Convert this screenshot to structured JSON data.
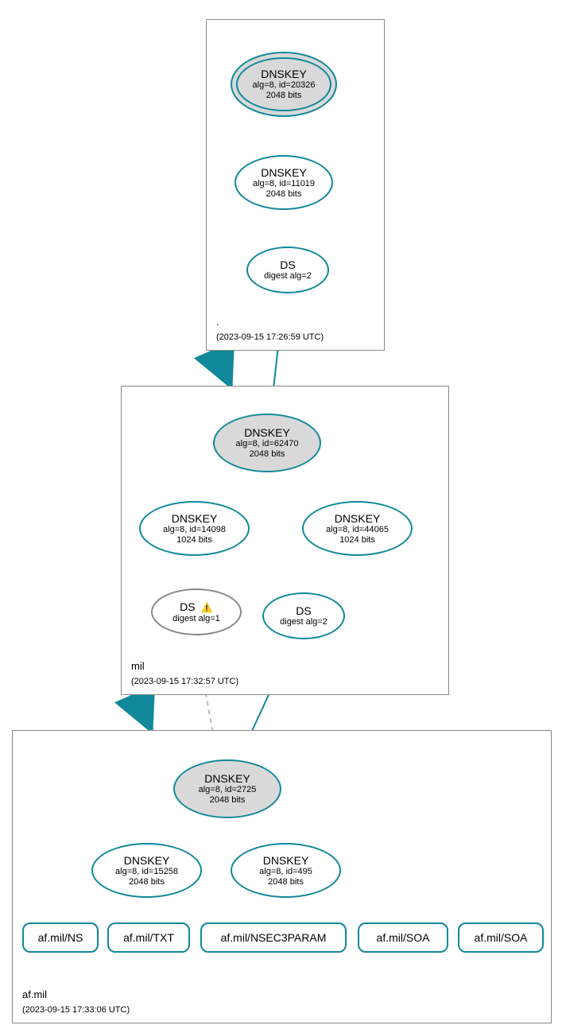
{
  "zones": {
    "root": {
      "label": ".",
      "timestamp": "(2023-09-15 17:26:59 UTC)"
    },
    "mil": {
      "label": "mil",
      "timestamp": "(2023-09-15 17:32:57 UTC)"
    },
    "afmil": {
      "label": "af.mil",
      "timestamp": "(2023-09-15 17:33:06 UTC)"
    }
  },
  "nodes": {
    "root_ksk": {
      "title": "DNSKEY",
      "line2": "alg=8, id=20326",
      "line3": "2048 bits"
    },
    "root_zsk": {
      "title": "DNSKEY",
      "line2": "alg=8, id=11019",
      "line3": "2048 bits"
    },
    "root_ds": {
      "title": "DS",
      "line2": "digest alg=2"
    },
    "mil_ksk": {
      "title": "DNSKEY",
      "line2": "alg=8, id=62470",
      "line3": "2048 bits"
    },
    "mil_zsk1": {
      "title": "DNSKEY",
      "line2": "alg=8, id=14098",
      "line3": "1024 bits"
    },
    "mil_zsk2": {
      "title": "DNSKEY",
      "line2": "alg=8, id=44065",
      "line3": "1024 bits"
    },
    "mil_ds1": {
      "title": "DS",
      "line2": "digest alg=1",
      "warn": "⚠️"
    },
    "mil_ds2": {
      "title": "DS",
      "line2": "digest alg=2"
    },
    "af_ksk": {
      "title": "DNSKEY",
      "line2": "alg=8, id=2725",
      "line3": "2048 bits"
    },
    "af_zsk1": {
      "title": "DNSKEY",
      "line2": "alg=8, id=15258",
      "line3": "2048 bits"
    },
    "af_zsk2": {
      "title": "DNSKEY",
      "line2": "alg=8, id=495",
      "line3": "2048 bits"
    },
    "rr_ns": {
      "label": "af.mil/NS"
    },
    "rr_txt": {
      "label": "af.mil/TXT"
    },
    "rr_nsec": {
      "label": "af.mil/NSEC3PARAM"
    },
    "rr_soa1": {
      "label": "af.mil/SOA"
    },
    "rr_soa2": {
      "label": "af.mil/SOA"
    }
  }
}
